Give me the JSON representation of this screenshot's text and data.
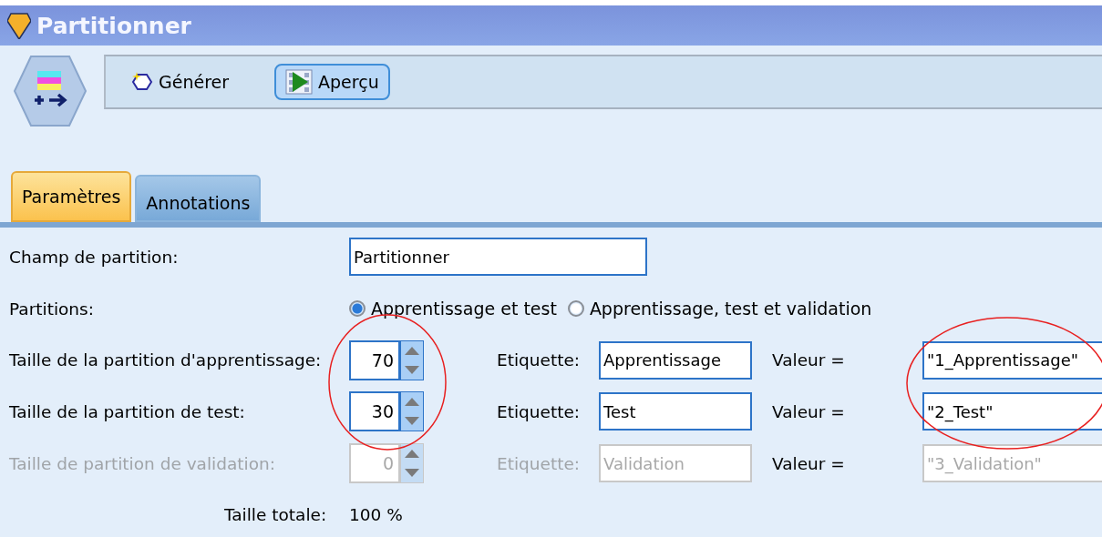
{
  "window": {
    "title": "Partitionner"
  },
  "toolbar": {
    "buttons": [
      {
        "kind": "generate",
        "label": "Générer",
        "selected": false
      },
      {
        "kind": "preview",
        "label": "Aperçu",
        "selected": true
      }
    ]
  },
  "tabs": [
    {
      "label": "Paramètres",
      "selected": true
    },
    {
      "label": "Annotations",
      "selected": false
    }
  ],
  "partition_field": {
    "label": "Champ de partition:",
    "value": "Partitionner"
  },
  "partitions": {
    "label": "Partitions:",
    "options": [
      {
        "label": "Apprentissage et test",
        "selected": true
      },
      {
        "label": "Apprentissage, test et validation",
        "selected": false
      }
    ]
  },
  "size_rows": [
    {
      "label": "Taille de la partition d'apprentissage:",
      "size": "70",
      "disabled": false,
      "tag_label": "Etiquette:",
      "tag": "Apprentissage",
      "value_label": "Valeur =",
      "value": "\"1_Apprentissage\""
    },
    {
      "label": "Taille de la partition de test:",
      "size": "30",
      "disabled": false,
      "tag_label": "Etiquette:",
      "tag": "Test",
      "value_label": "Valeur =",
      "value": "\"2_Test\""
    },
    {
      "label": "Taille de partition de validation:",
      "size": "0",
      "disabled": true,
      "tag_label": "Etiquette:",
      "tag": "Validation",
      "value_label": "Valeur =",
      "value": "\"3_Validation\""
    }
  ],
  "total": {
    "label": "Taille totale:",
    "value": "100 %"
  }
}
